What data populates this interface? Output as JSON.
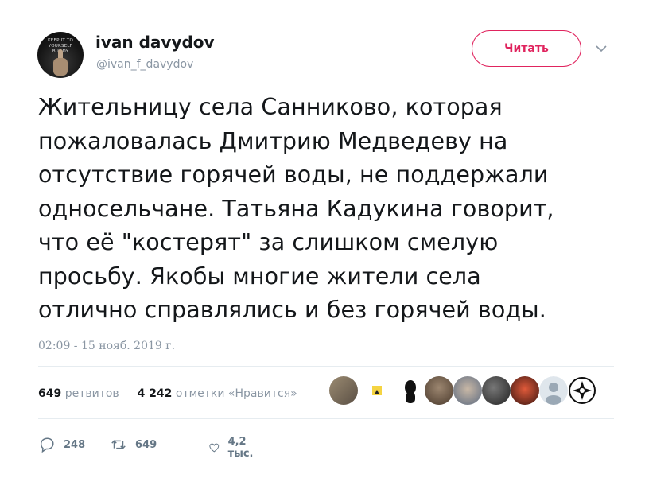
{
  "user": {
    "name": "ivan davydov",
    "handle": "@ivan_f_davydov",
    "avatar_caption": "KEEP IT TO YOURSELF BUDDY"
  },
  "follow_button": {
    "label": "Читать"
  },
  "tweet": {
    "text": "Жительницу села Санниково, которая\nпожаловалась Дмитрию Медведеву на\nотсутствие горячей воды, не поддержали\nодносельчане. Татьяна Кадукина говорит,\nчто её \"костерят\" за слишком смелую\nпросьбу. Якобы многие жители села\nотлично справлялись и без горячей воды.",
    "timestamp": "02:09 - 15 нояб. 2019 г."
  },
  "stats": {
    "retweets_count": "649",
    "retweets_label": "ретвитов",
    "likes_count": "4 242",
    "likes_label": "отметки «Нравится»"
  },
  "liker_avatars": [
    {
      "name": "liker-avatar-1",
      "color": "#8b7d6b"
    },
    {
      "name": "liker-avatar-2",
      "color": "#f5d442"
    },
    {
      "name": "liker-avatar-3",
      "color": "#111111"
    },
    {
      "name": "liker-avatar-4",
      "color": "#6b5a4a"
    },
    {
      "name": "liker-avatar-5",
      "color": "#7a8aa0"
    },
    {
      "name": "liker-avatar-6",
      "color": "#3a3a3a"
    },
    {
      "name": "liker-avatar-7",
      "color": "#b0402a"
    },
    {
      "name": "liker-avatar-8",
      "color": "#c8d0d8"
    },
    {
      "name": "liker-avatar-9",
      "color": "#ffffff"
    }
  ],
  "actions": {
    "replies": "248",
    "retweets": "649",
    "likes": "4,2 тыс."
  },
  "colors": {
    "accent": "#e0245e",
    "muted": "#8a96a3",
    "text": "#14171a"
  }
}
